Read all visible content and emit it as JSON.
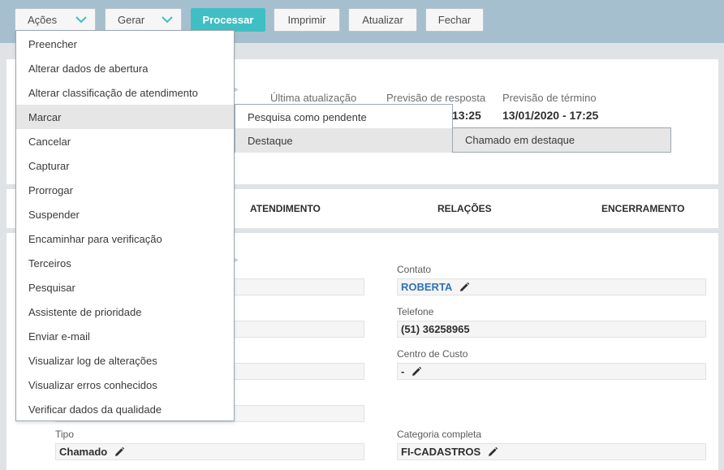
{
  "toolbar": {
    "acoes_label": "Ações",
    "gerar_label": "Gerar",
    "processar_label": "Processar",
    "imprimir_label": "Imprimir",
    "atualizar_label": "Atualizar",
    "fechar_label": "Fechar"
  },
  "header": {
    "ultima_atualizacao_label": "Última atualização",
    "previsao_resposta_label": "Previsão de resposta",
    "previsao_resposta_value": "13:25",
    "previsao_termino_label": "Previsão de término",
    "previsao_termino_value": "13/01/2020 - 17:25"
  },
  "tabs": {
    "atendimento": "ATENDIMENTO",
    "relacoes": "RELAÇÕES",
    "encerramento": "ENCERRAMENTO"
  },
  "form": {
    "contato_label": "Contato",
    "contato_value": "ROBERTA",
    "telefone_label": "Telefone",
    "telefone_value": "(51) 36258965",
    "centro_custo_label": "Centro de Custo",
    "centro_custo_value": "-",
    "tipo_label": "Tipo",
    "tipo_value": "Chamado",
    "categoria_label": "Categoria completa",
    "categoria_value": "FI-CADASTROS"
  },
  "actions_menu": {
    "items": [
      "Preencher",
      "Alterar dados de abertura",
      "Alterar classificação de atendimento",
      "Marcar",
      "Cancelar",
      "Capturar",
      "Prorrogar",
      "Suspender",
      "Encaminhar para verificação",
      "Terceiros",
      "Pesquisar",
      "Assistente de prioridade",
      "Enviar e-mail",
      "Visualizar log de alterações",
      "Visualizar erros conhecidos",
      "Verificar dados da qualidade"
    ]
  },
  "marcar_submenu": {
    "items": [
      "Pesquisa como pendente",
      "Destaque"
    ]
  },
  "destaque_submenu": {
    "items": [
      "Chamado em destaque"
    ]
  },
  "colors": {
    "toolbar_bg": "#a5bfce",
    "primary_button": "#3fbfc4",
    "link": "#2f73b7"
  }
}
